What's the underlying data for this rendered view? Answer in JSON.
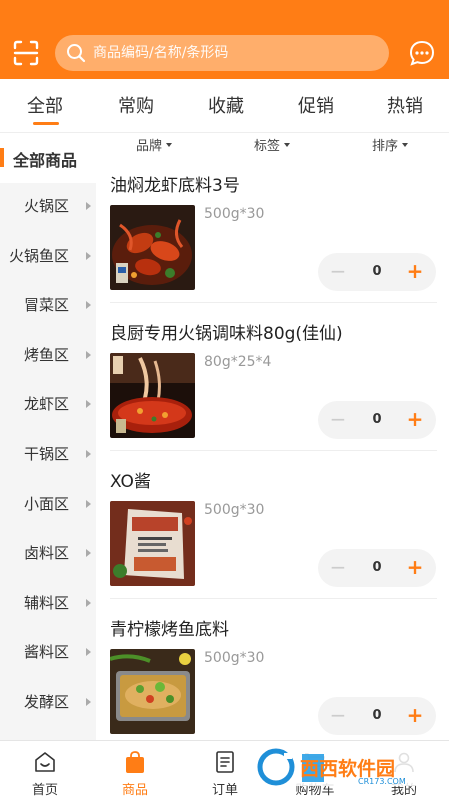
{
  "header": {
    "search_placeholder": "商品编码/名称/条形码",
    "accent_color": "#ff7d15"
  },
  "tabs": [
    {
      "label": "全部",
      "active": true
    },
    {
      "label": "常购",
      "active": false
    },
    {
      "label": "收藏",
      "active": false
    },
    {
      "label": "促销",
      "active": false
    },
    {
      "label": "热销",
      "active": false
    }
  ],
  "sidebar": {
    "items": [
      {
        "label": "全部商品",
        "active": true
      },
      {
        "label": "火锅区"
      },
      {
        "label": "火锅鱼区"
      },
      {
        "label": "冒菜区"
      },
      {
        "label": "烤鱼区"
      },
      {
        "label": "龙虾区"
      },
      {
        "label": "干锅区"
      },
      {
        "label": "小面区"
      },
      {
        "label": "卤料区"
      },
      {
        "label": "辅料区"
      },
      {
        "label": "酱料区"
      },
      {
        "label": "发酵区"
      }
    ]
  },
  "filters": [
    {
      "label": "品牌",
      "icon": "caret-down-icon"
    },
    {
      "label": "标签",
      "icon": "caret-down-icon"
    },
    {
      "label": "排序",
      "icon": "caret-down-icon"
    }
  ],
  "products": [
    {
      "name": "油焖龙虾底料3号",
      "spec": "500g*30",
      "qty": "0"
    },
    {
      "name": "良厨专用火锅调味料80g(佳仙)",
      "spec": "80g*25*4",
      "qty": "0"
    },
    {
      "name": "XO酱",
      "spec": "500g*30",
      "qty": "0"
    },
    {
      "name": "青柠檬烤鱼底料",
      "spec": "500g*30",
      "qty": "0"
    }
  ],
  "stepper": {
    "minus": "−",
    "plus": "+"
  },
  "bottom_nav": [
    {
      "label": "首页",
      "icon": "home-icon"
    },
    {
      "label": "商品",
      "icon": "bag-icon",
      "active": true
    },
    {
      "label": "订单",
      "icon": "order-icon"
    },
    {
      "label": "购物车",
      "icon": "cart-icon"
    },
    {
      "label": "我的",
      "icon": "user-icon"
    }
  ],
  "watermark": {
    "title": "西西软件园",
    "url": "CR173.COM"
  }
}
